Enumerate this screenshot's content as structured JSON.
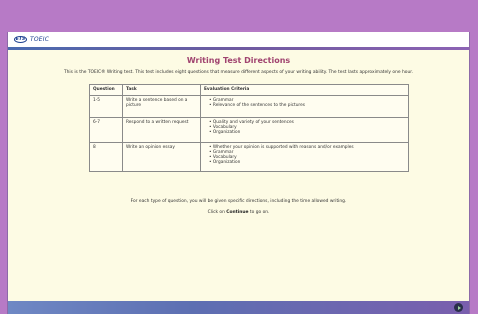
{
  "logo": {
    "ets": "ETS",
    "product": "TOEIC"
  },
  "page_title": "Writing Test Directions",
  "intro": "This is the TOEIC® Writing test. This test includes eight questions that measure different aspects of your writing ability. The test lasts approximately one hour.",
  "table": {
    "headers": [
      "Question",
      "Task",
      "Evaluation Criteria"
    ],
    "rows": [
      {
        "question": "1-5",
        "task": "Write a sentence based on a picture",
        "criteria": [
          "Grammar",
          "Relevance of the sentences to the pictures"
        ]
      },
      {
        "question": "6-7",
        "task": "Respond to a written request",
        "criteria": [
          "Quality and variety of your sentences",
          "Vocabulary",
          "Organization"
        ]
      },
      {
        "question": "8",
        "task": "Write an opinion essay",
        "criteria": [
          "Whether your opinion is supported with reasons and/or examples",
          "Grammar",
          "Vocabulary",
          "Organization"
        ]
      }
    ]
  },
  "note": "For each type of question, you will be given specific directions, including the time allowed writing.",
  "continue_instruction": {
    "prefix": "Click on ",
    "link": "Continue",
    "suffix": " to go on."
  }
}
